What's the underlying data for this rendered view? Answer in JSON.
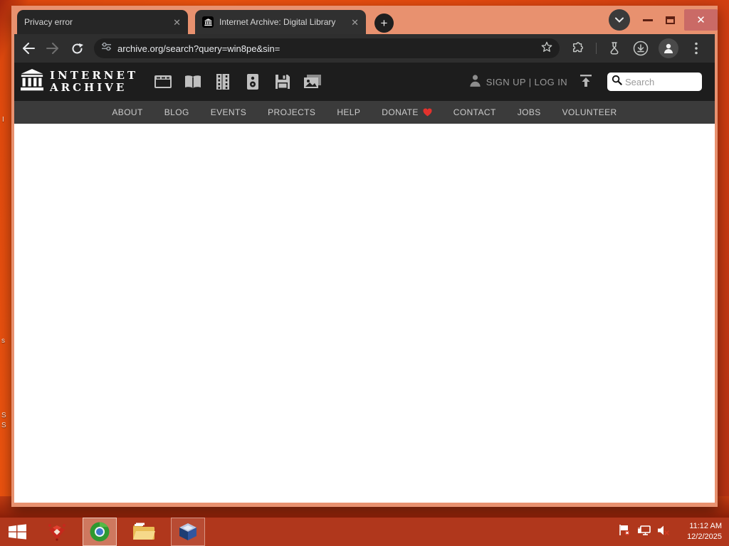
{
  "browser": {
    "tabs": [
      {
        "title": "Privacy error",
        "close_glyph": "✕"
      },
      {
        "title": "Internet Archive: Digital Library",
        "close_glyph": "✕",
        "favicon": "internet-archive-icon"
      }
    ],
    "new_tab_glyph": "+",
    "window_controls": {
      "close_glyph": "✕"
    },
    "toolbar": {
      "url": "archive.org/search?query=win8pe&sin="
    }
  },
  "ia": {
    "logo_line1": "INTERNET",
    "logo_line2": "ARCHIVE",
    "auth": "SIGN UP | LOG IN",
    "search_placeholder": "Search",
    "media_icons": [
      "web-icon",
      "texts-icon",
      "video-icon",
      "audio-icon",
      "software-icon",
      "images-icon"
    ],
    "nav": {
      "items": [
        "ABOUT",
        "BLOG",
        "EVENTS",
        "PROJECTS",
        "HELP",
        "DONATE",
        "CONTACT",
        "JOBS",
        "VOLUNTEER"
      ]
    }
  },
  "taskbar": {
    "time": "11:12 AM",
    "date": "12/2/2025",
    "apps": [
      "start-button",
      "red-app-icon",
      "chromium-green-icon",
      "file-explorer-icon",
      "virtualbox-icon"
    ],
    "tray_icons": [
      "action-center-flag-icon",
      "network-icon",
      "volume-muted-icon"
    ]
  },
  "desktop": {
    "fragments": [
      "I",
      "s",
      "S",
      "S"
    ]
  },
  "colors": {
    "titlebar": "#e8916f",
    "toolbar": "#2e2e2e",
    "omnibox": "#1f1f1f",
    "ia_header": "#1d1d1d",
    "ia_nav": "#3b3b3b",
    "taskbar": "#b0371c",
    "close_button": "#ca6a66",
    "donate_heart": "#e3322d",
    "desktop_orange": "#e4490f"
  }
}
